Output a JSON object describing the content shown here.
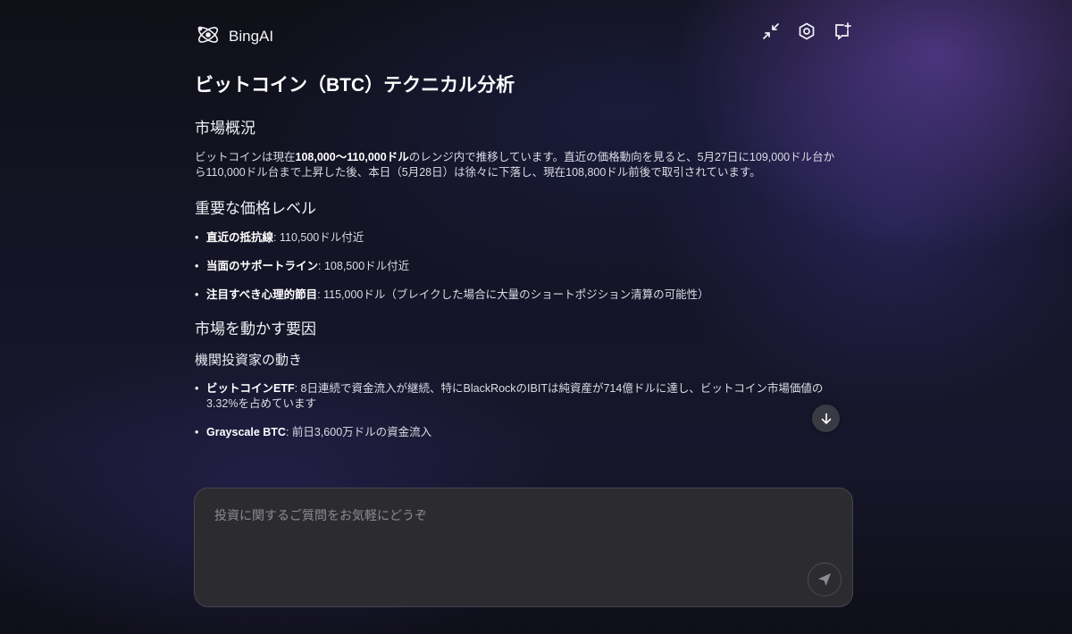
{
  "app": {
    "name": "BingAI"
  },
  "header": {
    "icons": [
      "logo-atom-icon",
      "minimize-arrows-icon",
      "settings-hexagon-icon",
      "new-chat-icon"
    ]
  },
  "article": {
    "title": "ビットコイン（BTC）テクニカル分析",
    "section1": {
      "heading": "市場概況",
      "para_pre": "ビットコインは現在",
      "para_bold": "108,000〜110,000ドル",
      "para_post": "のレンジ内で推移しています。直近の価格動向を見ると、5月27日に109,000ドル台から110,000ドル台まで上昇した後、本日（5月28日）は徐々に下落し、現在108,800ドル前後で取引されています。"
    },
    "section2": {
      "heading": "重要な価格レベル",
      "items": [
        {
          "label": "直近の抵抗線",
          "text": ": 110,500ドル付近"
        },
        {
          "label": "当面のサポートライン",
          "text": ": 108,500ドル付近"
        },
        {
          "label": "注目すべき心理的節目",
          "text": ": 115,000ドル（ブレイクした場合に大量のショートポジション清算の可能性）"
        }
      ]
    },
    "section3": {
      "heading": "市場を動かす要因",
      "subheading": "機関投資家の動き",
      "items": [
        {
          "label": "ビットコインETF",
          "text": ": 8日連続で資金流入が継続、特にBlackRockのIBITは純資産が714億ドルに達し、ビットコイン市場価値の3.32%を占めています"
        },
        {
          "label": "Grayscale BTC",
          "text": ": 前日3,600万ドルの資金流入"
        }
      ]
    }
  },
  "composer": {
    "placeholder": "投資に関するご質問をお気軽にどうぞ",
    "value": ""
  },
  "colors": {
    "accent": "#6b5bd6",
    "background": "#141426",
    "composer": "#2c2c30"
  }
}
